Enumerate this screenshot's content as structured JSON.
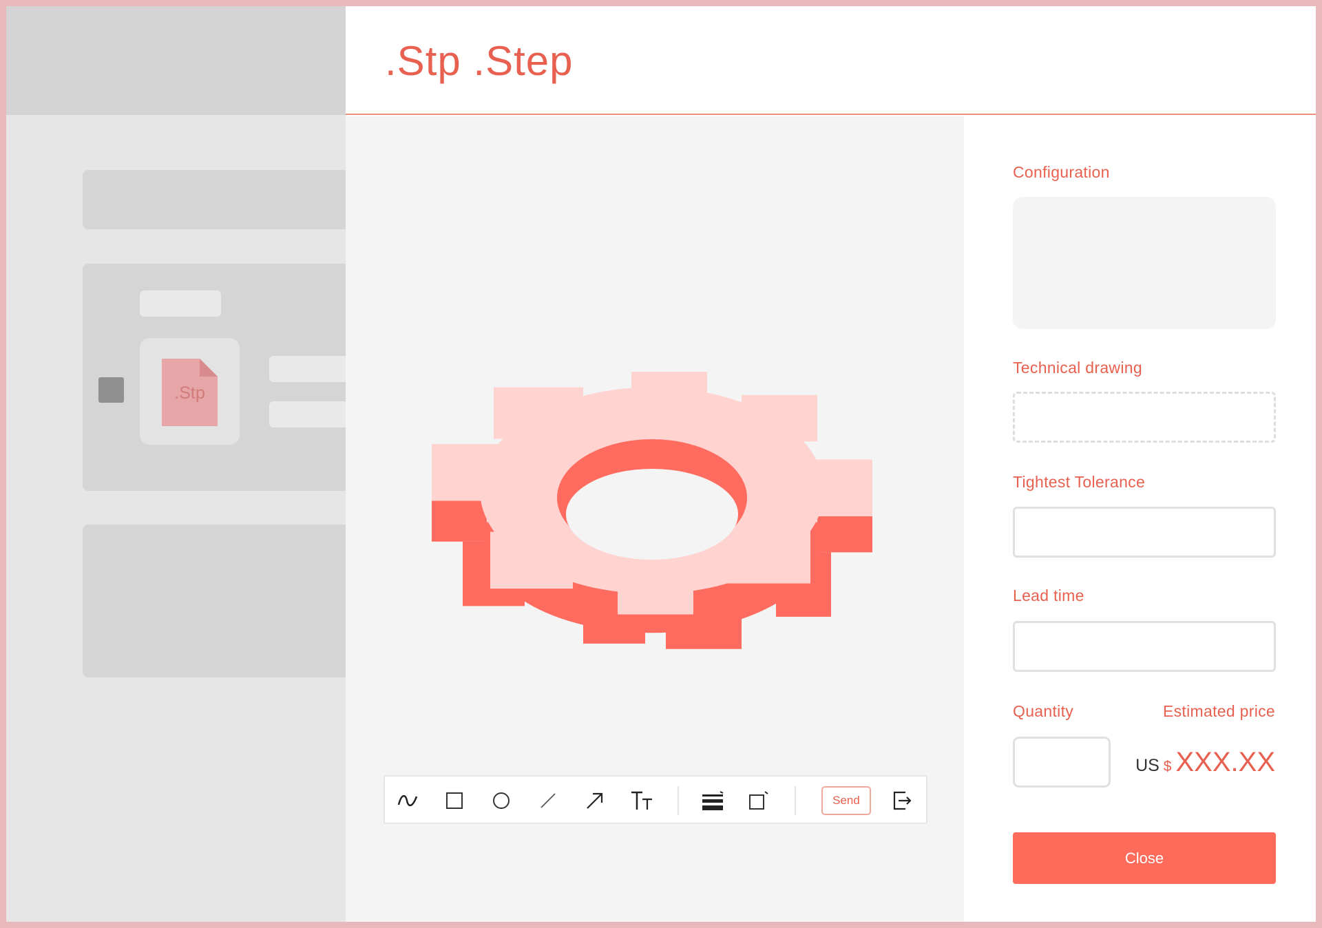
{
  "background_app": {
    "file_label": ".Stp"
  },
  "modal": {
    "title": ".Stp .Step"
  },
  "toolbar": {
    "tools": [
      "freehand-icon",
      "rectangle-icon",
      "circle-icon",
      "line-icon",
      "arrow-icon",
      "text-icon",
      "stroke-weight-icon",
      "fill-icon"
    ],
    "send_label": "Send",
    "exit_icon": "exit-icon"
  },
  "panel": {
    "configuration_label": "Configuration",
    "technical_drawing_label": "Technical drawing",
    "tightest_tolerance_label": "Tightest Tolerance",
    "lead_time_label": "Lead time",
    "quantity_label": "Quantity",
    "estimated_price_label": "Estimated price",
    "price_currency": "US",
    "price_symbol": "$",
    "price_value": "XXX.XX",
    "close_label": "Close"
  },
  "colors": {
    "accent": "#e8604f",
    "button": "#ff6b5a",
    "gear_top": "#ffd3d0",
    "gear_side": "#ff6b5f"
  }
}
